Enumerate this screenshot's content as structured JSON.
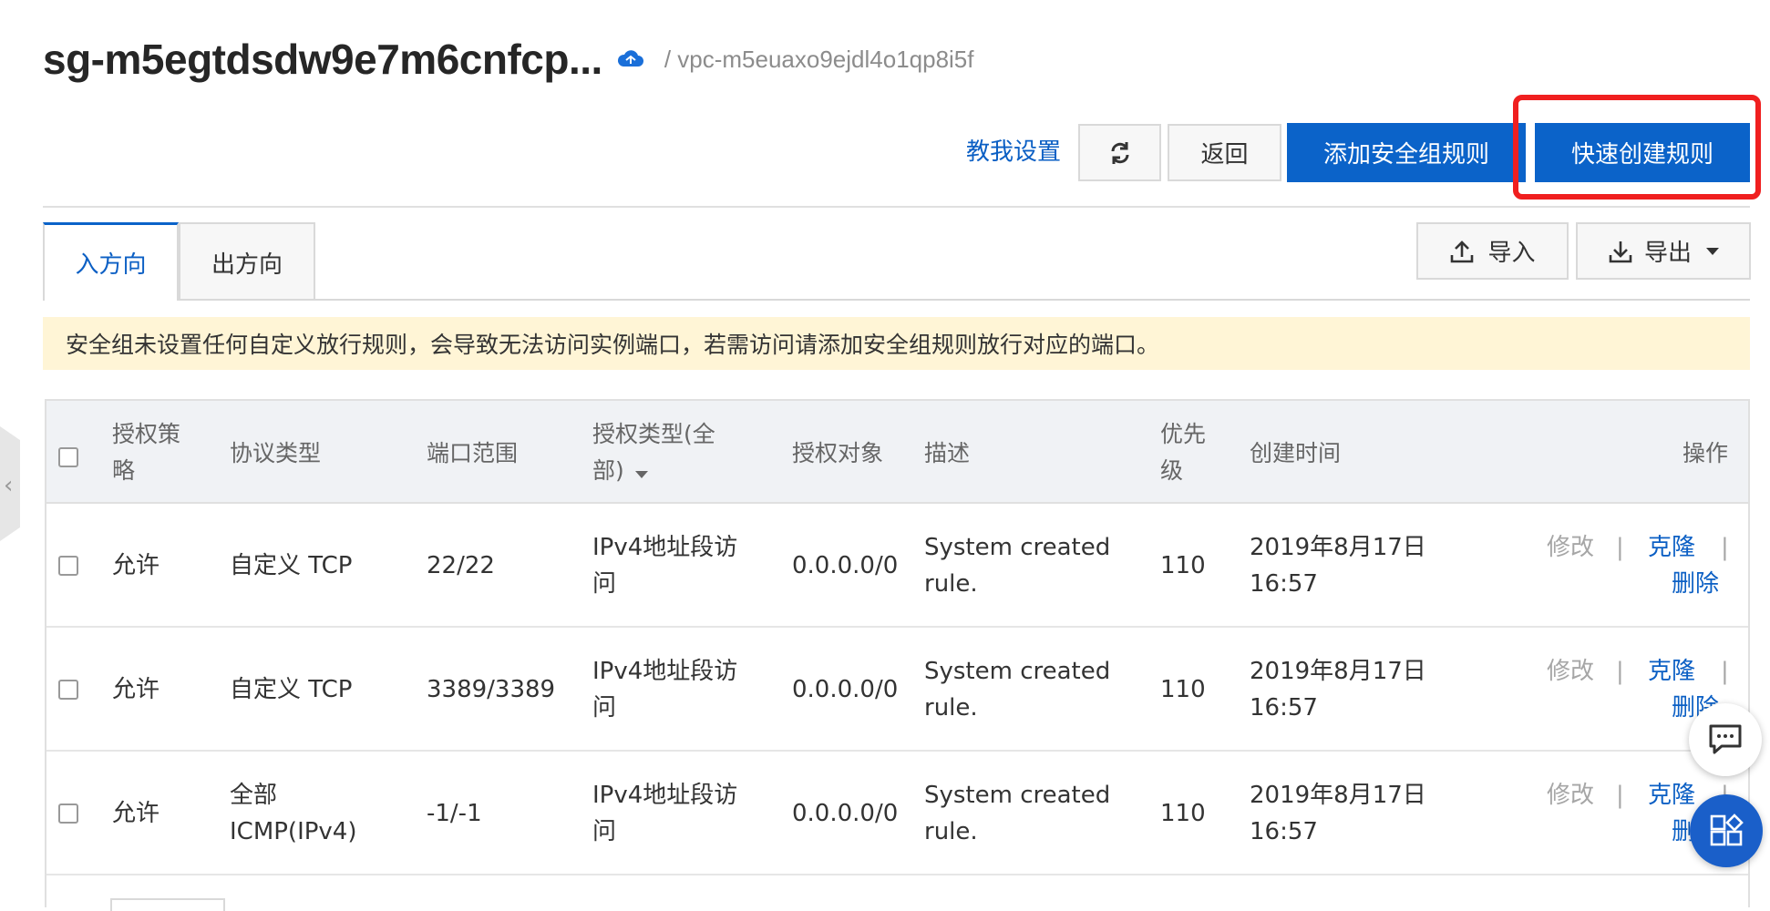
{
  "header": {
    "sg_name": "sg-m5egtdsdw9e7m6cnfcp...",
    "vpc_path": "/ vpc-m5euaxo9ejdl4o1qp8i5f"
  },
  "toolbar": {
    "guide_link": "教我设置",
    "back_label": "返回",
    "add_rule_label": "添加安全组规则",
    "quick_create_label": "快速创建规则",
    "highlight_color": "#f01f1f",
    "primary_color": "#0b63c9"
  },
  "tabs": [
    {
      "label": "入方向",
      "active": true
    },
    {
      "label": "出方向",
      "active": false
    }
  ],
  "actions": {
    "import_label": "导入",
    "export_label": "导出"
  },
  "notice": {
    "text": "安全组未设置任何自定义放行规则，会导致无法访问实例端口，若需访问请添加安全组规则放行对应的端口。"
  },
  "table": {
    "headers": {
      "policy": [
        "授权策",
        "略"
      ],
      "protocol": "协议类型",
      "port": "端口范围",
      "auth_type": [
        "授权类型(全",
        "部)"
      ],
      "target": "授权对象",
      "desc": "描述",
      "priority": [
        "优先",
        "级"
      ],
      "created": "创建时间",
      "ops": "操作"
    },
    "rows": [
      {
        "policy": "允许",
        "protocol": [
          "自定义 TCP"
        ],
        "port": "22/22",
        "auth_type": [
          "IPv4地址段访",
          "问"
        ],
        "target": "0.0.0.0/0",
        "desc": [
          "System created",
          "rule."
        ],
        "priority": "110",
        "created": [
          "2019年8月17日",
          "16:57"
        ],
        "op_edit": "修改",
        "op_clone": "克隆",
        "op_delete": "删除"
      },
      {
        "policy": "允许",
        "protocol": [
          "自定义 TCP"
        ],
        "port": "3389/3389",
        "auth_type": [
          "IPv4地址段访",
          "问"
        ],
        "target": "0.0.0.0/0",
        "desc": [
          "System created",
          "rule."
        ],
        "priority": "110",
        "created": [
          "2019年8月17日",
          "16:57"
        ],
        "op_edit": "修改",
        "op_clone": "克隆",
        "op_delete": "删除"
      },
      {
        "policy": "允许",
        "protocol": [
          "全部",
          "ICMP(IPv4)"
        ],
        "port": "-1/-1",
        "auth_type": [
          "IPv4地址段访",
          "问"
        ],
        "target": "0.0.0.0/0",
        "desc": [
          "System created",
          "rule."
        ],
        "priority": "110",
        "created": [
          "2019年8月17日",
          "16:57"
        ],
        "op_edit": "修改",
        "op_clone": "克隆",
        "op_delete": "删除"
      }
    ],
    "separator": "|"
  },
  "icons": {
    "cloud": "cloud-sync-icon",
    "refresh": "refresh-icon",
    "import": "upload-icon",
    "export": "download-icon",
    "chat": "chat-icon",
    "apps": "apps-icon"
  }
}
